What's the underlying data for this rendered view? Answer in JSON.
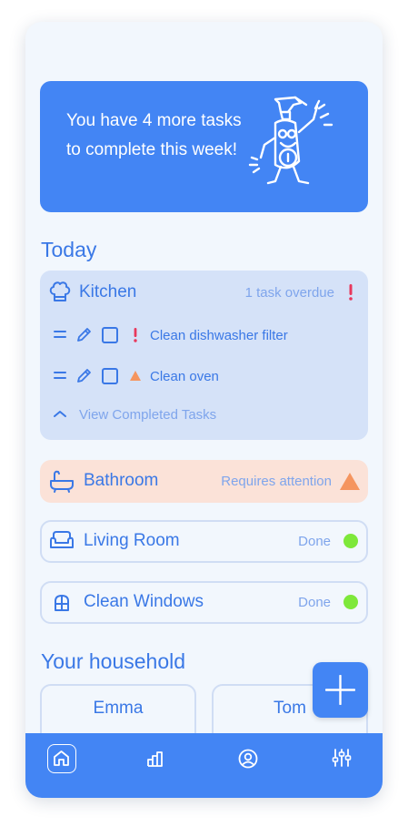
{
  "banner": {
    "message": "You have 4 more tasks to complete this week!"
  },
  "today": {
    "title": "Today",
    "kitchen": {
      "name": "Kitchen",
      "status": "1 task overdue",
      "tasks": [
        {
          "label": "Clean dishwasher filter",
          "priority": "overdue"
        },
        {
          "label": "Clean oven",
          "priority": "warning"
        }
      ],
      "view_completed": "View Completed Tasks"
    },
    "bathroom": {
      "name": "Bathroom",
      "status": "Requires attention"
    },
    "living_room": {
      "name": "Living Room",
      "status": "Done"
    },
    "clean_windows": {
      "name": "Clean Windows",
      "status": "Done"
    }
  },
  "household": {
    "title": "Your household",
    "members": [
      "Emma",
      "Tom"
    ]
  },
  "nav": {
    "tabs": [
      "home-icon",
      "stats-icon",
      "profile-icon",
      "settings-icon"
    ]
  },
  "colors": {
    "primary": "#4385f4",
    "text": "#3a78e6",
    "muted": "#7fa5ec",
    "overdue": "#e8385c",
    "warning": "#f5955f",
    "done": "#7ee83a",
    "bathroom_bg": "#fbe2d8",
    "kitchen_bg": "#d5e2f8"
  }
}
